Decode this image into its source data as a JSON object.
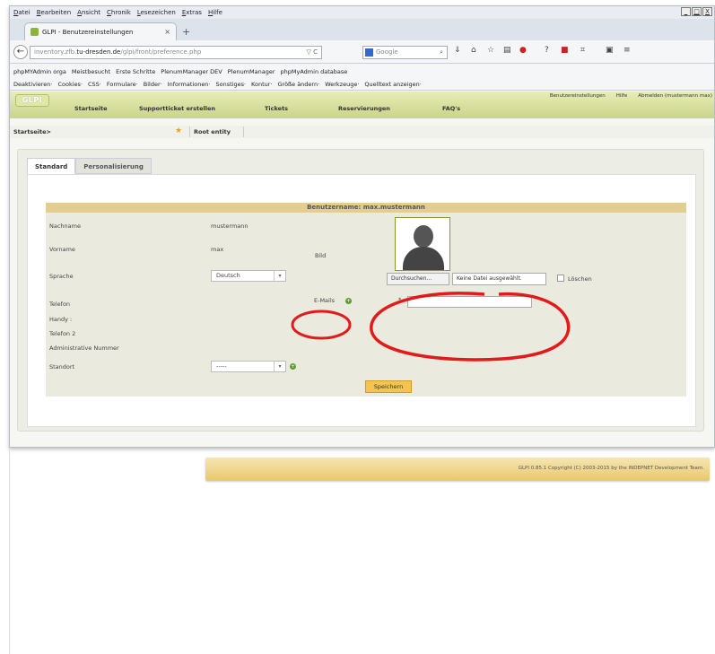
{
  "browser": {
    "menu": [
      "Datei",
      "Bearbeiten",
      "Ansicht",
      "Chronik",
      "Lesezeichen",
      "Extras",
      "Hilfe"
    ],
    "window_controls": [
      "_",
      "□",
      "X"
    ],
    "tab_title": "GLPI - Benutzereinstellungen",
    "tab_close": "×",
    "new_tab": "+",
    "url_host": "inventory.zfb.tu-dresden.de",
    "url_prefix": "inventory.zfb.",
    "url_rest": "/glpi/front/preference.php",
    "url_dropdown": "▽ C",
    "search_placeholder": "Google",
    "search_glyph": "⌕",
    "bookmarks_row1": [
      "phpMYAdmin orga",
      "Meistbesucht",
      "Erste Schritte",
      "PlenumManager DEV",
      "PlenumManager",
      "phpMyAdmin database"
    ],
    "bookmarks_row2": [
      "Deaktivieren·",
      "Cookies·",
      "CSS·",
      "Formulare·",
      "Bilder·",
      "Informationen·",
      "Sonstiges·",
      "Kontur·",
      "Größe ändern·",
      "Werkzeuge·",
      "Quelltext anzeigen·"
    ]
  },
  "glpi": {
    "logo": "GLPI",
    "top_links": [
      "Benutzereinstellungen",
      "Hilfe",
      "Abmelden (mustermann max)"
    ],
    "main_menu": [
      "Startseite",
      "Supportticket erstellen",
      "Tickets",
      "Reservierungen",
      "FAQ's"
    ],
    "breadcrumb_home": "Startseite>",
    "entity": "Root entity",
    "tabs": [
      "Standard",
      "Personalisierung"
    ],
    "form_title": "Benutzername: max.mustermann",
    "labels": {
      "nachname": "Nachname",
      "vorname": "Vorname",
      "sprache": "Sprache",
      "telefon": "Telefon",
      "handy": "Handy :",
      "telefon2": "Telefon 2",
      "admin_number": "Administrative Nummer",
      "standort": "Standort",
      "bild": "Bild",
      "email": "E-Mails",
      "loeschen": "Löschen"
    },
    "values": {
      "nachname": "mustermann",
      "vorname": "max",
      "sprache": "Deutsch",
      "standort": "-----"
    },
    "file_button": "Durchsuchen...",
    "file_status": "Keine Datei ausgewählt.",
    "select_arrow": "▾",
    "email_plus": "+",
    "email_star": "*",
    "save_button": "Speichern",
    "footer": "GLPI 0.85.1 Copyright (C) 2003-2015 by the INDEPNET Development Team."
  }
}
